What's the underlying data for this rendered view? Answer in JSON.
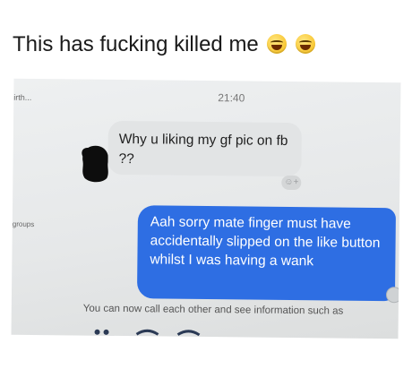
{
  "caption": {
    "text": "This has fucking killed me",
    "emojis": [
      "laughing-crying-emoji",
      "laughing-crying-emoji"
    ]
  },
  "conversation": {
    "contact_name": "irth...",
    "timestamp": "21:40",
    "side_label": "groups",
    "incoming_message": "Why u liking my gf pic on fb ??",
    "outgoing_message": "Aah sorry mate finger must have accidentally slipped on the like button whilst I was having a wank",
    "system_notice": "You can now call each other and see information such as",
    "reaction_icon": "add-reaction-icon",
    "colors": {
      "outgoing_bubble": "#2e6ee3",
      "incoming_bubble": "#e2e4e5"
    }
  }
}
